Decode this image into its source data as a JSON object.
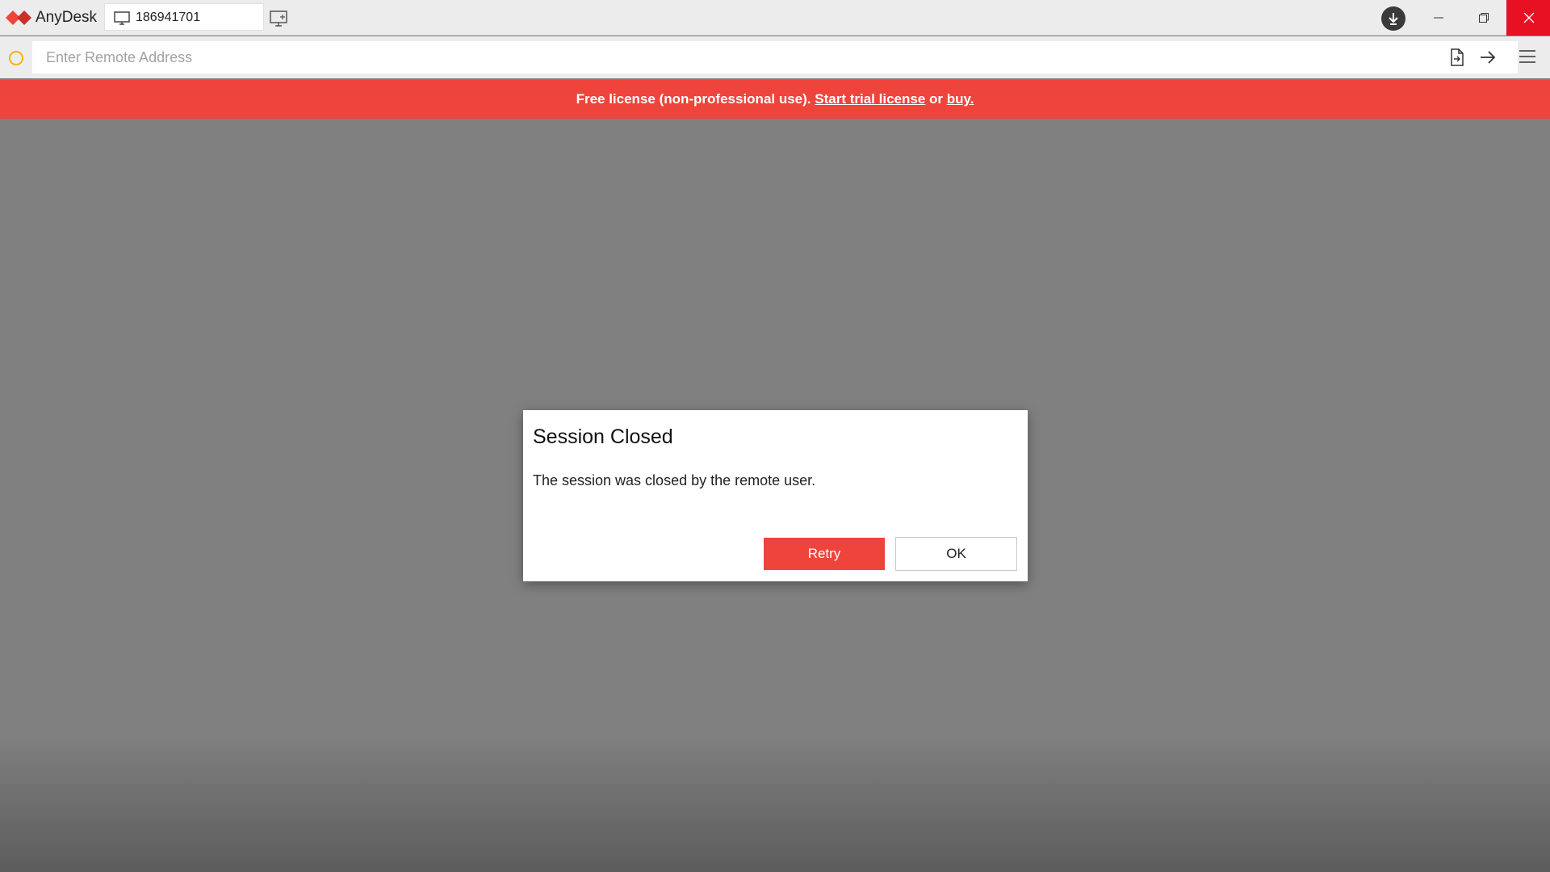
{
  "app": {
    "name": "AnyDesk",
    "brand_color": "#ef443b"
  },
  "titlebar": {
    "session_tab_label": "186941701",
    "session_tab_icon": "monitor-icon",
    "new_tab_icon": "new-session-monitor-icon",
    "download_icon": "download-icon",
    "window_controls": [
      "minimize-icon",
      "restore-icon",
      "close-icon"
    ]
  },
  "addressbar": {
    "value": "",
    "placeholder": "Enter Remote Address",
    "status_icon": "status-ring-icon",
    "status_color": "#f5b400",
    "actions": [
      "file-transfer-icon",
      "connect-arrow-icon",
      "hamburger-menu-icon"
    ]
  },
  "banner": {
    "text": "Free license (non-professional use).",
    "trial_link": "Start trial license",
    "connector": "or",
    "buy_link": "buy."
  },
  "dialog": {
    "title": "Session Closed",
    "message": "The session was closed by the remote user.",
    "retry_label": "Retry",
    "ok_label": "OK"
  }
}
